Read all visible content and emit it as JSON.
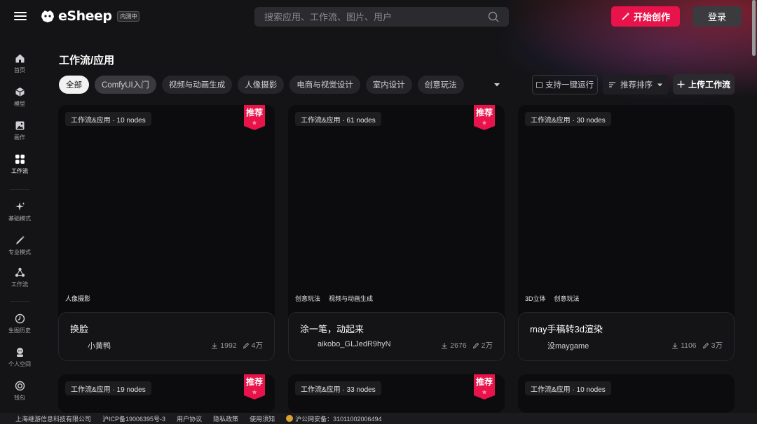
{
  "header": {
    "brand": "eSheep",
    "beta_badge": "内测中",
    "search_placeholder": "搜索应用、工作流、图片、用户",
    "create_label": "开始创作",
    "login_label": "登录"
  },
  "sidebar": {
    "items": [
      {
        "label": "首页",
        "icon": "home-icon"
      },
      {
        "label": "模型",
        "icon": "cube-icon"
      },
      {
        "label": "画作",
        "icon": "image-icon"
      },
      {
        "label": "工作流",
        "icon": "grid-icon"
      },
      {
        "label": "基础模式",
        "icon": "sparkle-icon"
      },
      {
        "label": "专业模式",
        "icon": "brush-icon"
      },
      {
        "label": "工作流",
        "icon": "nodes-icon"
      },
      {
        "label": "生图历史",
        "icon": "history-icon"
      },
      {
        "label": "个人空间",
        "icon": "user-icon"
      },
      {
        "label": "钱包",
        "icon": "wallet-icon"
      }
    ]
  },
  "main": {
    "title": "工作流/应用",
    "chips": [
      "全部",
      "ComfyUI入门",
      "视频与动画生成",
      "人像摄影",
      "电商与视觉设计",
      "室内设计",
      "创意玩法"
    ],
    "oneclick_label": "支持一键运行",
    "sort_label": "推荐排序",
    "upload_label": "上传工作流"
  },
  "cards": [
    {
      "meta": "工作流&应用 · 10 nodes",
      "recommended": true,
      "tags": [
        "人像摄影"
      ],
      "title": "换脸",
      "author": "小黄鸭",
      "downloads": "1992",
      "uses": "4万"
    },
    {
      "meta": "工作流&应用 · 61 nodes",
      "recommended": true,
      "tags": [
        "创意玩法",
        "视频与动画生成"
      ],
      "title": "涂一笔，动起来",
      "author": "aikobo_GLJedR9hyN",
      "downloads": "2676",
      "uses": "2万"
    },
    {
      "meta": "工作流&应用 · 30 nodes",
      "recommended": false,
      "tags": [
        "3D立体",
        "创意玩法"
      ],
      "title": "may手稿转3d渲染",
      "author": "没maygame",
      "downloads": "1106",
      "uses": "3万"
    },
    {
      "meta": "工作流&应用 · 19 nodes",
      "recommended": true
    },
    {
      "meta": "工作流&应用 · 33 nodes",
      "recommended": true
    },
    {
      "meta": "工作流&应用 · 10 nodes",
      "recommended": false
    }
  ],
  "ribbon_label": "推荐",
  "footer": {
    "company": "上海继游信息科技有限公司",
    "icp": "沪ICP备19006395号-3",
    "terms": "用户协议",
    "privacy": "隐私政策",
    "notice": "使用须知",
    "police": "沪公网安备：31011002006494"
  },
  "colors": {
    "accent": "#e8134a",
    "background": "#141416",
    "card": "#0c0c0e"
  }
}
